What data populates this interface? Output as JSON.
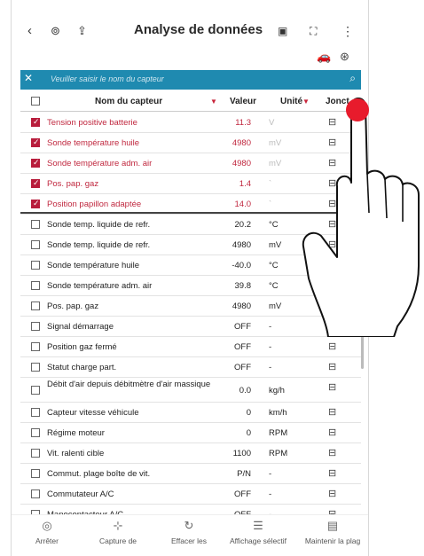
{
  "app": {
    "title": "Analyse de données"
  },
  "search": {
    "placeholder": "Veuiller saisir le nom du capteur"
  },
  "columns": {
    "name": "Nom du capteur",
    "value": "Valeur",
    "unit": "Unité",
    "junction": "Jonct."
  },
  "rows": [
    {
      "name": "Tension positive batterie",
      "value": "11.3",
      "unit": "V",
      "checked": true
    },
    {
      "name": "Sonde température huile",
      "value": "4980",
      "unit": "mV",
      "checked": true
    },
    {
      "name": "Sonde température adm. air",
      "value": "4980",
      "unit": "mV",
      "checked": true
    },
    {
      "name": "Pos. pap. gaz",
      "value": "1.4",
      "unit": "`",
      "checked": true
    },
    {
      "name": "Position papillon adaptée",
      "value": "14.0",
      "unit": "`",
      "checked": true
    },
    {
      "name": "Sonde temp. liquide de refr.",
      "value": "20.2",
      "unit": "°C",
      "checked": false
    },
    {
      "name": "Sonde temp. liquide de refr.",
      "value": "4980",
      "unit": "mV",
      "checked": false
    },
    {
      "name": "Sonde température huile",
      "value": "-40.0",
      "unit": "°C",
      "checked": false
    },
    {
      "name": "Sonde température adm. air",
      "value": "39.8",
      "unit": "°C",
      "checked": false
    },
    {
      "name": "Pos. pap. gaz",
      "value": "4980",
      "unit": "mV",
      "checked": false
    },
    {
      "name": "Signal démarrage",
      "value": "OFF",
      "unit": "-",
      "checked": false
    },
    {
      "name": "Position gaz fermé",
      "value": "OFF",
      "unit": "-",
      "checked": false
    },
    {
      "name": "Statut charge part.",
      "value": "OFF",
      "unit": "-",
      "checked": false
    },
    {
      "name": "Débit d'air depuis débitmètre d'air massique",
      "value": "0.0",
      "unit": "kg/h",
      "checked": false
    },
    {
      "name": "Capteur vitesse véhicule",
      "value": "0",
      "unit": "km/h",
      "checked": false
    },
    {
      "name": "Régime moteur",
      "value": "0",
      "unit": "RPM",
      "checked": false
    },
    {
      "name": "Vit. ralenti cible",
      "value": "1100",
      "unit": "RPM",
      "checked": false
    },
    {
      "name": "Commut. plage boîte de vit.",
      "value": "P/N",
      "unit": "-",
      "checked": false
    },
    {
      "name": "Commutateur A/C",
      "value": "OFF",
      "unit": "-",
      "checked": false
    },
    {
      "name": "Manocontacteur A/C",
      "value": "OFF",
      "unit": "-",
      "checked": false
    }
  ],
  "bottom": {
    "stop": "Arrêter",
    "capture": "Capture de",
    "clear": "Effacer les",
    "display": "Affichage sélectif",
    "hold": "Maintenir la plag"
  },
  "icons": {
    "back": "chevron-left-icon",
    "vehicle": "vehicle-icon",
    "export": "export-icon",
    "record": "record-icon",
    "fullscreen": "fullscreen-icon",
    "menu": "more-vert-icon",
    "car": "car-icon",
    "settings": "settings-icon",
    "junction": "junction-icon"
  },
  "colors": {
    "accent": "#1f8ab0",
    "selected": "#c0283f",
    "touch": "#e81b2c"
  }
}
